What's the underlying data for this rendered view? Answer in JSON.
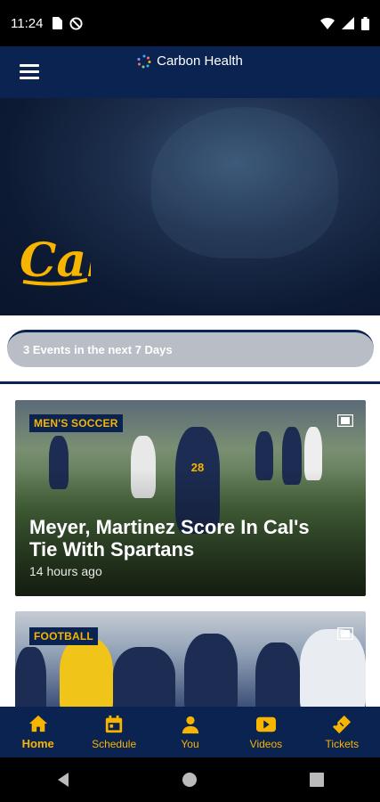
{
  "status_bar": {
    "time": "11:24"
  },
  "header": {
    "brand": "Carbon Health"
  },
  "hero": {
    "logo_text": "Cal"
  },
  "events": {
    "label": "3 Events in the next 7 Days"
  },
  "feed": {
    "cards": [
      {
        "tag": "MEN'S SOCCER",
        "title": "Meyer, Martinez Score In Cal's Tie With Spartans",
        "time": "14 hours ago",
        "jersey": "28"
      },
      {
        "tag": "FOOTBALL"
      }
    ]
  },
  "bottom_nav": {
    "items": [
      {
        "label": "Home",
        "icon": "home-icon",
        "active": true
      },
      {
        "label": "Schedule",
        "icon": "calendar-icon"
      },
      {
        "label": "You",
        "icon": "person-icon"
      },
      {
        "label": "Videos",
        "icon": "play-icon"
      },
      {
        "label": "Tickets",
        "icon": "ticket-icon"
      }
    ]
  },
  "colors": {
    "navy": "#0b2350",
    "gold": "#f7b500",
    "pill": "#b9bec6"
  }
}
